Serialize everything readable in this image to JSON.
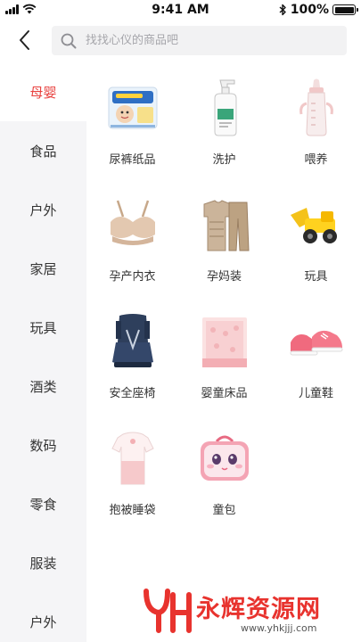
{
  "status_bar": {
    "time": "9:41 AM",
    "battery": "100%",
    "battery_level": 1.0
  },
  "header": {
    "back_icon": "chevron-left-icon",
    "search_icon": "search-icon",
    "search_placeholder": "找找心仪的商品吧"
  },
  "sidebar": {
    "items": [
      {
        "label": "母婴",
        "active": true
      },
      {
        "label": "食品",
        "active": false
      },
      {
        "label": "户外",
        "active": false
      },
      {
        "label": "家居",
        "active": false
      },
      {
        "label": "玩具",
        "active": false
      },
      {
        "label": "酒类",
        "active": false
      },
      {
        "label": "数码",
        "active": false
      },
      {
        "label": "零食",
        "active": false
      },
      {
        "label": "服装",
        "active": false
      },
      {
        "label": "户外",
        "active": false
      }
    ]
  },
  "categories": [
    {
      "label": "尿裤纸品",
      "icon": "diaper-pack-icon"
    },
    {
      "label": "洗护",
      "icon": "lotion-bottle-icon"
    },
    {
      "label": "喂养",
      "icon": "baby-bottle-icon"
    },
    {
      "label": "孕产内衣",
      "icon": "bra-icon"
    },
    {
      "label": "孕妈装",
      "icon": "maternity-outfit-icon"
    },
    {
      "label": "玩具",
      "icon": "toy-truck-icon"
    },
    {
      "label": "安全座椅",
      "icon": "car-seat-icon"
    },
    {
      "label": "婴童床品",
      "icon": "bedding-icon"
    },
    {
      "label": "儿童鞋",
      "icon": "kids-shoe-icon"
    },
    {
      "label": "抱被睡袋",
      "icon": "sleeping-bag-icon"
    },
    {
      "label": "童包",
      "icon": "kids-bag-icon"
    }
  ],
  "watermark": {
    "logo_icon": "yh-logo-icon",
    "title": "永辉资源网",
    "url": "www.yhkjjj.com"
  },
  "colors": {
    "accent": "#e8423f",
    "sidebar_bg": "#f5f5f7",
    "search_bg": "#f2f2f3"
  }
}
